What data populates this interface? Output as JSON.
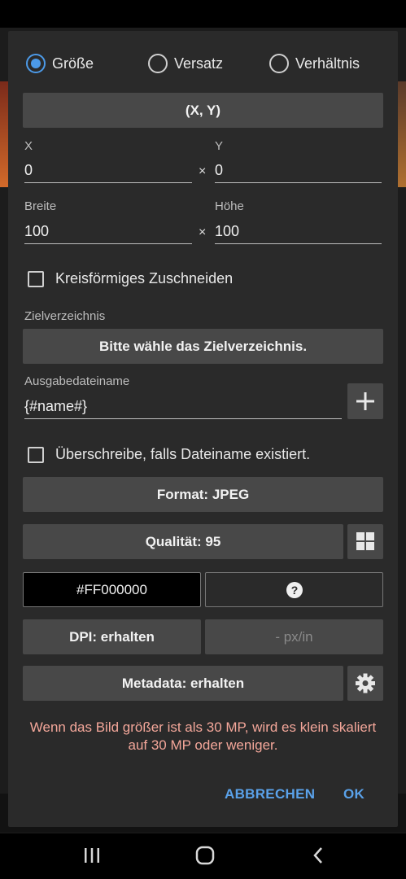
{
  "radio_options": [
    {
      "label": "Größe",
      "checked": true
    },
    {
      "label": "Versatz",
      "checked": false
    },
    {
      "label": "Verhältnis",
      "checked": false
    }
  ],
  "xy_button": "(X, Y)",
  "x": {
    "label": "X",
    "value": "0"
  },
  "y": {
    "label": "Y",
    "value": "0"
  },
  "width": {
    "label": "Breite",
    "value": "100"
  },
  "height": {
    "label": "Höhe",
    "value": "100"
  },
  "times_symbol": "×",
  "circular_crop": {
    "label": "Kreisförmiges Zuschneiden",
    "checked": false
  },
  "target_dir": {
    "label": "Zielverzeichnis",
    "button": "Bitte wähle das Zielverzeichnis."
  },
  "output_name": {
    "label": "Ausgabedateiname",
    "value": "{#name#}"
  },
  "overwrite": {
    "label": "Überschreibe, falls Dateiname existiert.",
    "checked": false
  },
  "format_button": "Format: JPEG",
  "quality_button": "Qualität: 95",
  "color_button": "#FF000000",
  "dpi_button": "DPI: erhalten",
  "dpi_unit_button": "- px/in",
  "metadata_button": "Metadata: erhalten",
  "warning": "Wenn das Bild größer ist als 30 MP, wird es klein skaliert auf 30 MP oder weniger.",
  "actions": {
    "cancel": "ABBRECHEN",
    "ok": "OK"
  },
  "colors": {
    "accent": "#4c9ae8",
    "warning": "#f4a79a",
    "button": "#484848",
    "dialog": "#2a2a2a"
  },
  "icons": [
    "plus-icon",
    "grid-icon",
    "help-icon",
    "gear-icon",
    "recents-icon",
    "home-icon",
    "back-icon"
  ]
}
